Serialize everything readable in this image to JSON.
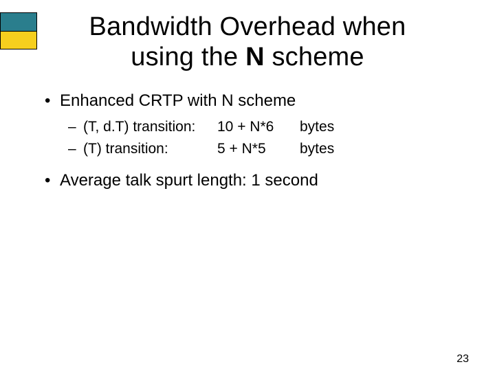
{
  "title": {
    "line1": "Bandwidth Overhead when",
    "line2_prefix": "using the ",
    "line2_bold": "N",
    "line2_suffix": " scheme"
  },
  "bullets": {
    "b1": "Enhanced CRTP with N scheme",
    "b2": "Average talk spurt length: 1 second"
  },
  "sub": {
    "dash": "–",
    "items": [
      {
        "label": "(T, d.T) transition:",
        "value": "10 + N*6",
        "unit": "bytes"
      },
      {
        "label": "(T) transition:",
        "value": "5 + N*5",
        "unit": "bytes"
      }
    ]
  },
  "page_number": "23"
}
